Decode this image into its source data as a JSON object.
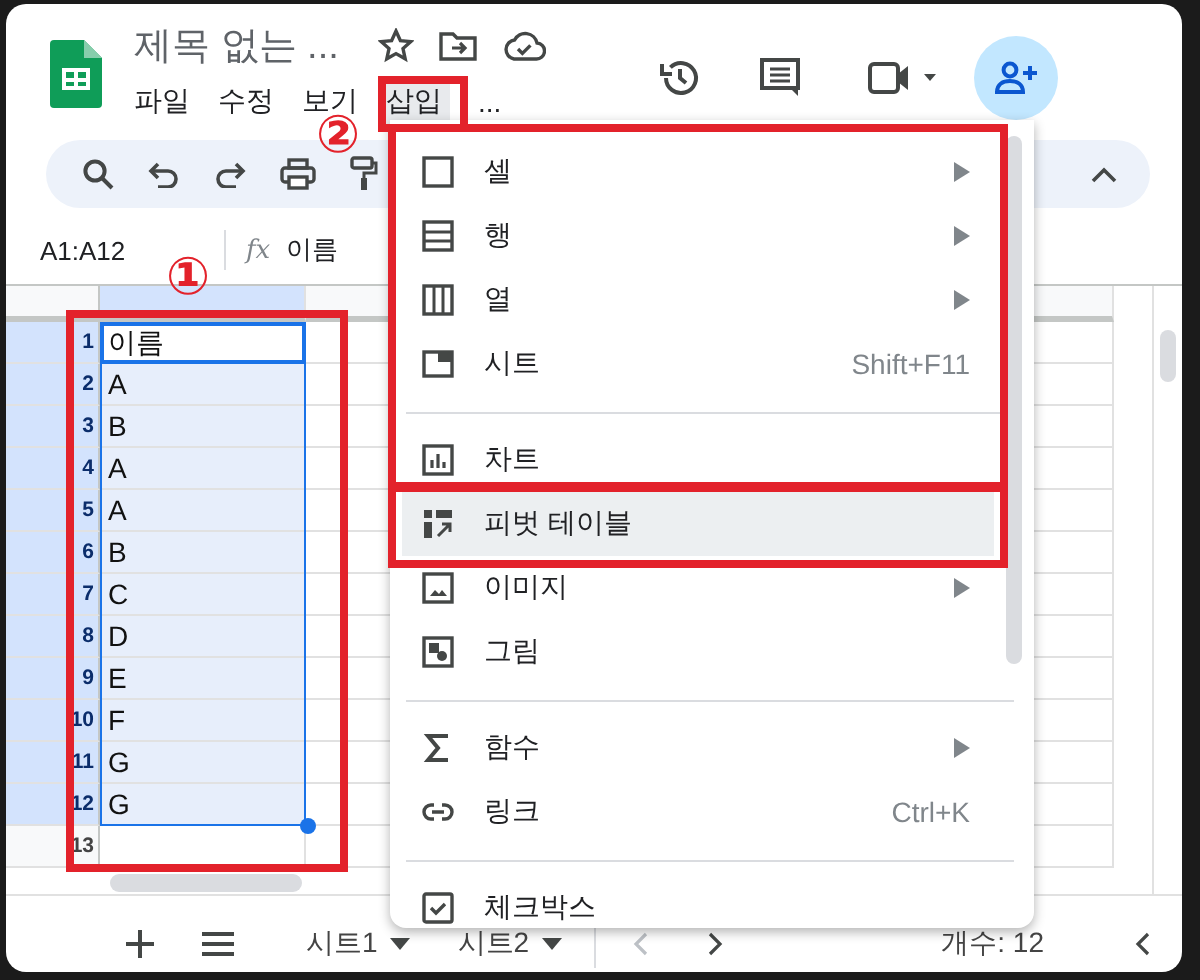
{
  "header": {
    "title": "제목 없는 ...",
    "menus": [
      {
        "label": "파일",
        "selected": false
      },
      {
        "label": "수정",
        "selected": false
      },
      {
        "label": "보기",
        "selected": false
      },
      {
        "label": "삽입",
        "selected": true
      },
      {
        "label": "...",
        "selected": false
      }
    ]
  },
  "formula_bar": {
    "cell_range": "A1:A12",
    "fx": "fx",
    "value": "이름"
  },
  "grid": {
    "rows": [
      {
        "number": "1",
        "value": "이름",
        "selected": true
      },
      {
        "number": "2",
        "value": "A",
        "selected": true
      },
      {
        "number": "3",
        "value": "B",
        "selected": true
      },
      {
        "number": "4",
        "value": "A",
        "selected": true
      },
      {
        "number": "5",
        "value": "A",
        "selected": true
      },
      {
        "number": "6",
        "value": "B",
        "selected": true
      },
      {
        "number": "7",
        "value": "C",
        "selected": true
      },
      {
        "number": "8",
        "value": "D",
        "selected": true
      },
      {
        "number": "9",
        "value": "E",
        "selected": true
      },
      {
        "number": "10",
        "value": "F",
        "selected": true
      },
      {
        "number": "11",
        "value": "G",
        "selected": true
      },
      {
        "number": "12",
        "value": "G",
        "selected": true
      },
      {
        "number": "13",
        "selected": false
      }
    ]
  },
  "insert_menu": {
    "items": [
      {
        "kind": "item",
        "label": "셀",
        "submenu": true,
        "selected": false
      },
      {
        "kind": "item",
        "label": "행",
        "submenu": true,
        "selected": false
      },
      {
        "kind": "item",
        "label": "열",
        "submenu": true,
        "selected": false
      },
      {
        "kind": "item",
        "label": "시트",
        "shortcut": "Shift+F11",
        "submenu": false,
        "selected": false
      },
      {
        "kind": "divider"
      },
      {
        "kind": "item",
        "label": "차트",
        "submenu": false,
        "selected": false
      },
      {
        "kind": "item",
        "label": "피벗 테이블",
        "submenu": false,
        "selected": true
      },
      {
        "kind": "item",
        "label": "이미지",
        "submenu": true,
        "selected": false
      },
      {
        "kind": "item",
        "label": "그림",
        "submenu": false,
        "selected": false
      },
      {
        "kind": "divider"
      },
      {
        "kind": "item",
        "label": "함수",
        "submenu": true,
        "selected": false
      },
      {
        "kind": "item",
        "label": "링크",
        "shortcut": "Ctrl+K",
        "submenu": false,
        "selected": false
      },
      {
        "kind": "divider"
      },
      {
        "kind": "item",
        "label": "체크박스",
        "submenu": false,
        "selected": false
      }
    ]
  },
  "bottom_bar": {
    "sheets": [
      {
        "label": "시트1"
      },
      {
        "label": "시트2"
      }
    ],
    "status": "개수: 12"
  },
  "annotations": [
    {
      "label": "①"
    },
    {
      "label": "②"
    }
  ]
}
